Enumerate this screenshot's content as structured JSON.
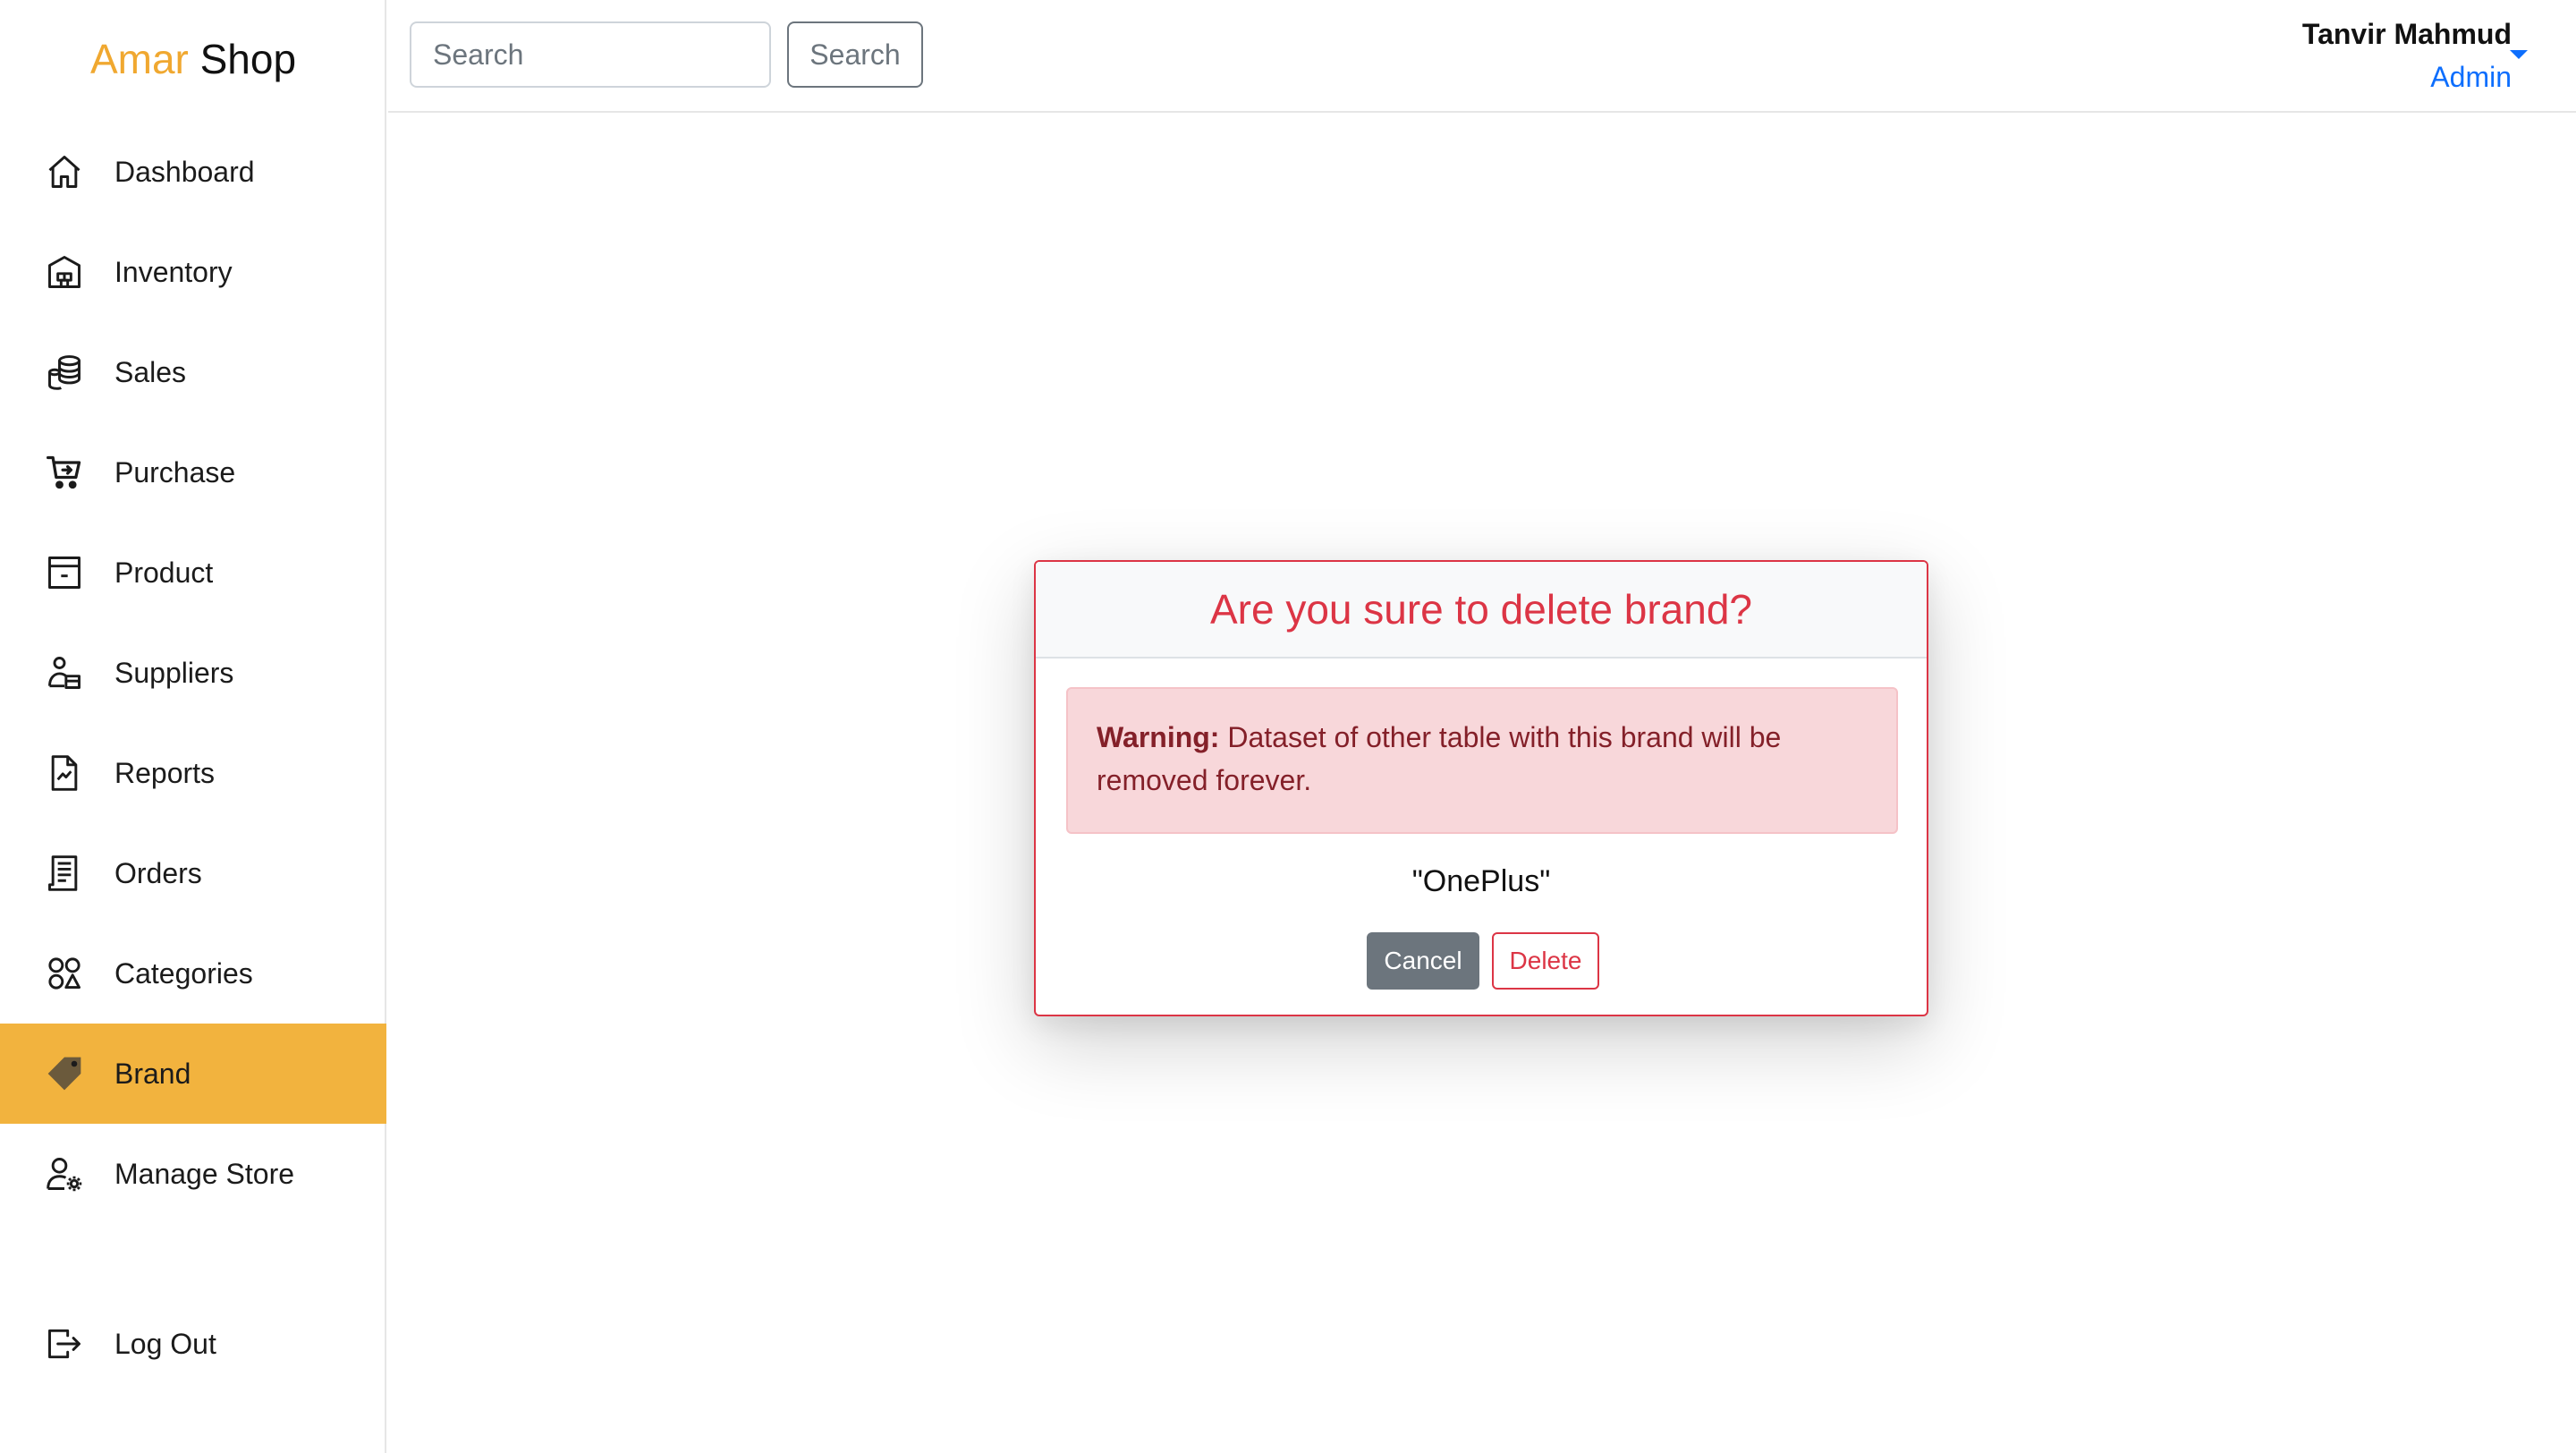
{
  "app": {
    "name_part1": "Amar",
    "name_part2": "Shop"
  },
  "sidebar": {
    "items": [
      {
        "label": "Dashboard",
        "icon": "home-icon"
      },
      {
        "label": "Inventory",
        "icon": "warehouse-icon"
      },
      {
        "label": "Sales",
        "icon": "coins-icon"
      },
      {
        "label": "Purchase",
        "icon": "cart-icon"
      },
      {
        "label": "Product",
        "icon": "archive-box-icon"
      },
      {
        "label": "Suppliers",
        "icon": "supplier-icon"
      },
      {
        "label": "Reports",
        "icon": "report-icon"
      },
      {
        "label": "Orders",
        "icon": "receipt-icon"
      },
      {
        "label": "Categories",
        "icon": "categories-icon"
      },
      {
        "label": "Brand",
        "icon": "tag-icon",
        "active": true
      },
      {
        "label": "Manage Store",
        "icon": "user-gear-icon"
      },
      {
        "label": "Log Out",
        "icon": "logout-icon"
      }
    ]
  },
  "header": {
    "search_placeholder": "Search",
    "search_button": "Search",
    "user_name": "Tanvir Mahmud",
    "user_role": "Admin"
  },
  "modal": {
    "title": "Are you sure to delete brand?",
    "warning_label": "Warning:",
    "warning_text": "Dataset of other table with this brand will be removed forever.",
    "item_name": "\"OnePlus\"",
    "cancel_label": "Cancel",
    "delete_label": "Delete"
  },
  "colors": {
    "accent": "#f2b33e",
    "danger": "#dc3545",
    "link": "#0d6efd"
  }
}
